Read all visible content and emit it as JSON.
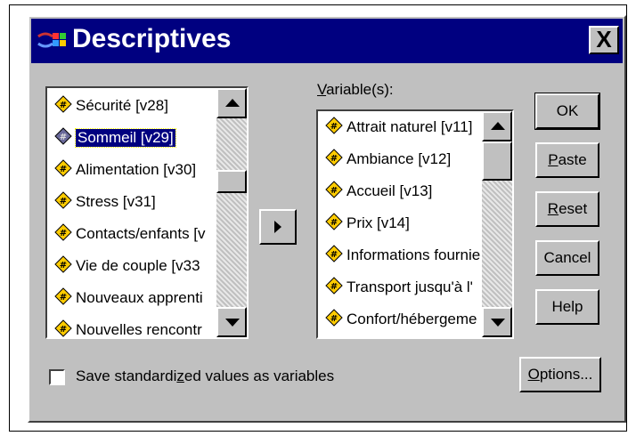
{
  "window": {
    "title": "Descriptives",
    "close_label": "X"
  },
  "source_list": {
    "items": [
      {
        "label": "Sécurité [v28]",
        "selected": false
      },
      {
        "label": "Sommeil [v29]",
        "selected": true
      },
      {
        "label": "Alimentation [v30]",
        "selected": false
      },
      {
        "label": "Stress [v31]",
        "selected": false
      },
      {
        "label": "Contacts/enfants [v",
        "selected": false
      },
      {
        "label": "Vie de couple [v33",
        "selected": false
      },
      {
        "label": "Nouveaux apprenti",
        "selected": false
      },
      {
        "label": "Nouvelles rencontr",
        "selected": false
      }
    ]
  },
  "variables": {
    "label_prefix": "V",
    "label_rest": "ariable(s):",
    "items": [
      {
        "label": "Attrait naturel [v11]"
      },
      {
        "label": "Ambiance [v12]"
      },
      {
        "label": "Accueil [v13]"
      },
      {
        "label": "Prix [v14]"
      },
      {
        "label": "Informations fournie"
      },
      {
        "label": "Transport jusqu'à l'"
      },
      {
        "label": "Confort/hébergeme"
      }
    ]
  },
  "buttons": {
    "ok": "OK",
    "paste_u": "P",
    "paste_rest": "aste",
    "reset_u": "R",
    "reset_rest": "eset",
    "cancel": "Cancel",
    "help": "Help",
    "options_u": "O",
    "options_rest": "ptions..."
  },
  "save_checkbox": {
    "checked": false,
    "label_a": "Save standardi",
    "label_u": "z",
    "label_b": "ed values as variables"
  },
  "colors": {
    "dialog": "#c0c0c0",
    "titlebar": "#000080",
    "selection": "#000080",
    "icon_fill": "#ffcc00"
  }
}
